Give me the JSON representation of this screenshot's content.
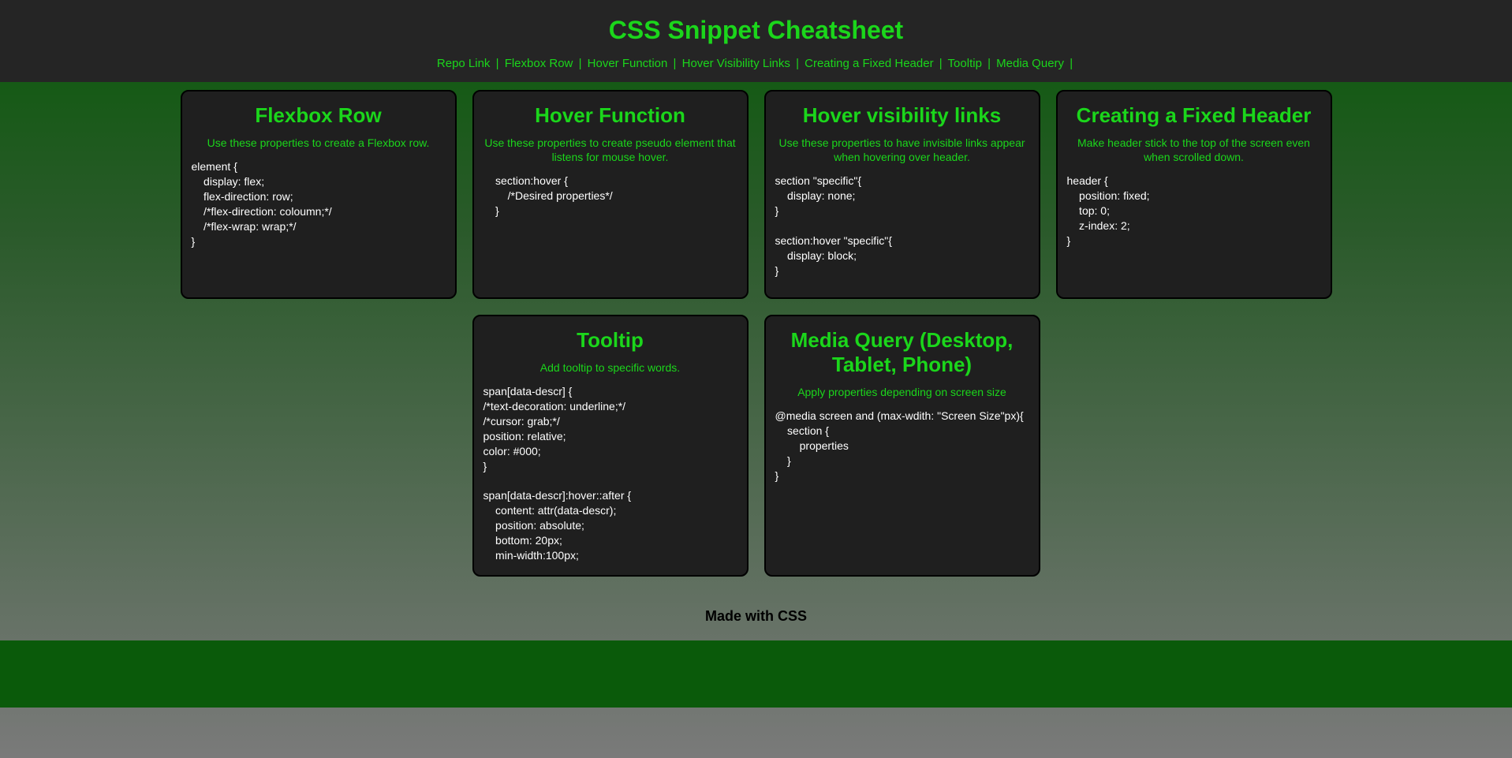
{
  "header": {
    "title": "CSS Snippet Cheatsheet",
    "nav": [
      "Repo Link",
      "Flexbox Row",
      "Hover Function",
      "Hover Visibility Links",
      "Creating a Fixed Header",
      "Tooltip",
      "Media Query"
    ]
  },
  "cards": [
    {
      "title": "Flexbox Row",
      "subtitle": "Use these properties to create a Flexbox row.",
      "code": "element {\n    display: flex;\n    flex-direction: row;\n    /*flex-direction: coloumn;*/\n    /*flex-wrap: wrap;*/\n}"
    },
    {
      "title": "Hover Function",
      "subtitle": "Use these properties to create pseudo element that listens for mouse hover.",
      "code": "    section:hover {\n        /*Desired properties*/\n    }"
    },
    {
      "title": "Hover visibility links",
      "subtitle": "Use these properties to have invisible links appear when hovering over header.",
      "code": "section \"specific\"{\n    display: none;\n}\n\nsection:hover \"specific\"{\n    display: block;\n}"
    },
    {
      "title": "Creating a Fixed Header",
      "subtitle": "Make header stick to the top of the screen even when scrolled down.",
      "code": "header {\n    position: fixed;\n    top: 0;\n    z-index: 2;\n}"
    },
    {
      "title": "Tooltip",
      "subtitle": "Add tooltip to specific words.",
      "code": "span[data-descr] {\n/*text-decoration: underline;*/\n/*cursor: grab;*/\nposition: relative;\ncolor: #000;\n}\n\nspan[data-descr]:hover::after {\n    content: attr(data-descr);\n    position: absolute;\n    bottom: 20px;\n    min-width:100px;"
    },
    {
      "title": "Media Query (Desktop, Tablet, Phone)",
      "subtitle": "Apply properties depending on screen size",
      "code": "@media screen and (max-wdith: \"Screen Size\"px){\n    section {\n        properties\n    }\n}"
    }
  ],
  "footer": {
    "text": "Made with CSS"
  }
}
